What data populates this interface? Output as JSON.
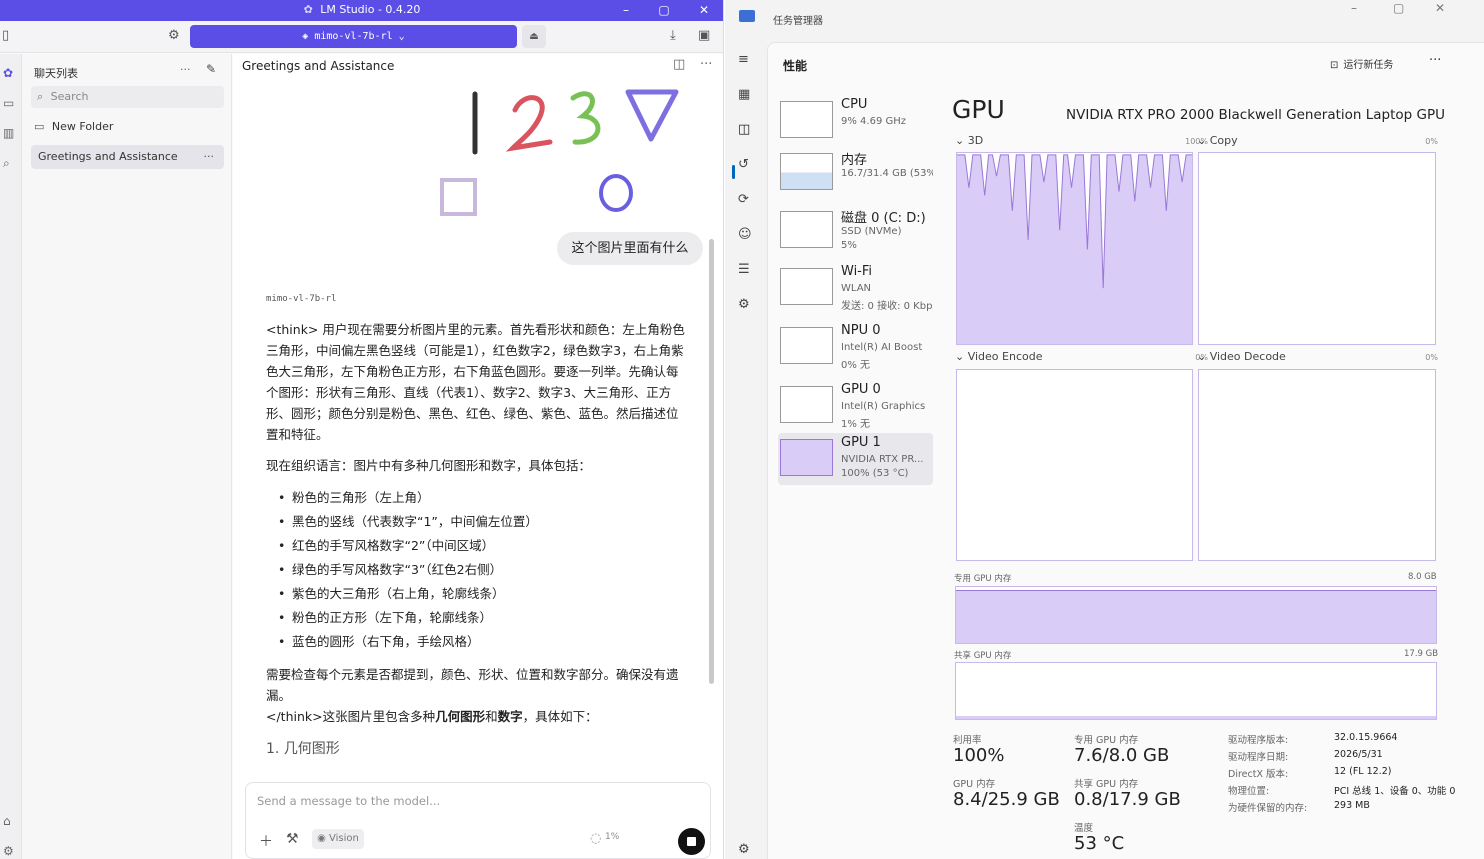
{
  "lmstudio": {
    "window_title": "LM Studio - 0.4.20",
    "model_selector": "mimo-vl-7b-rl",
    "sidebar": {
      "header": "聊天列表",
      "search_placeholder": "Search",
      "new_folder": "New Folder",
      "chats": [
        {
          "title": "Greetings and Assistance"
        }
      ]
    },
    "chat": {
      "title": "Greetings and Assistance",
      "user_message": "这个图片里面有什么",
      "model_tag": "mimo-vl-7b-rl",
      "think_p1": "<think> 用户现在需要分析图片里的元素。首先看形状和颜色：左上角粉色三角形，中间偏左黑色竖线（可能是1），红色数字2，绿色数字3，右上角紫色大三角形，左下角粉色正方形，右下角蓝色圆形。要逐一列举。先确认每个图形：形状有三角形、直线（代表1）、数字2、数字3、大三角形、正方形、圆形；颜色分别是粉色、黑色、红色、绿色、紫色、蓝色。然后描述位置和特征。",
      "think_p2": "现在组织语言：图片中有多种几何图形和数字，具体包括：",
      "bullets": [
        "粉色的三角形（左上角）",
        "黑色的竖线（代表数字“1”，中间偏左位置）",
        "红色的手写风格数字“2”（中间区域）",
        "绿色的手写风格数字“3”（红色2右侧）",
        "紫色的大三角形（右上角，轮廓线条）",
        "粉色的正方形（左下角，轮廓线条）",
        "蓝色的圆形（右下角，手绘风格）"
      ],
      "think_p3": "需要检查每个元素是否都提到，颜色、形状、位置和数字部分。确保没有遗漏。",
      "answer_prefix": "</think>这张图片里包含多种",
      "answer_bold1": "几何图形",
      "answer_mid": "和",
      "answer_bold2": "数字",
      "answer_suffix": "，具体如下：",
      "heading1": "1. 几何图形",
      "input_placeholder": "Send a message to the model...",
      "vision_label": "Vision",
      "context_usage": "1%"
    },
    "image_content": {
      "digits": [
        "1",
        "2",
        "3"
      ],
      "colors": {
        "digit1": "#333333",
        "digit2": "#d9545f",
        "digit3": "#78c155",
        "triangle": "#7e6fe0",
        "square": "#c8b8dc",
        "circle": "#6a5fe0"
      }
    }
  },
  "taskmanager": {
    "window_title": "任务管理器",
    "page_title": "性能",
    "run_new_task": "运行新任务",
    "devices": [
      {
        "name": "CPU",
        "sub1": "9%  4.69 GHz",
        "sub2": ""
      },
      {
        "name": "内存",
        "sub1": "16.7/31.4 GB (53%)",
        "sub2": ""
      },
      {
        "name": "磁盘 0 (C: D:)",
        "sub1": "SSD (NVMe)",
        "sub2": "5%"
      },
      {
        "name": "Wi-Fi",
        "sub1": "WLAN",
        "sub2": "发送: 0 接收: 0 Kbps"
      },
      {
        "name": "NPU 0",
        "sub1": "Intel(R) AI Boost",
        "sub2": "0% 无"
      },
      {
        "name": "GPU 0",
        "sub1": "Intel(R) Graphics",
        "sub2": "1% 无"
      },
      {
        "name": "GPU 1",
        "sub1": "NVIDIA RTX PR...",
        "sub2": "100% (53 °C)"
      }
    ],
    "gpu": {
      "title": "GPU",
      "model": "NVIDIA RTX PRO 2000 Blackwell Generation Laptop GPU",
      "engines": [
        {
          "label": "3D",
          "pct": "100%"
        },
        {
          "label": "Copy",
          "pct": "0%"
        },
        {
          "label": "Video Encode",
          "pct": "0%"
        },
        {
          "label": "Video Decode",
          "pct": "0%"
        }
      ],
      "dedicated_mem_label": "专用 GPU 内存",
      "dedicated_mem_max": "8.0 GB",
      "shared_mem_label": "共享 GPU 内存",
      "shared_mem_max": "17.9 GB",
      "stats": {
        "utilization_label": "利用率",
        "utilization": "100%",
        "dedicated_label": "专用 GPU 内存",
        "dedicated": "7.6/8.0 GB",
        "gpu_mem_label": "GPU 内存",
        "gpu_mem": "8.4/25.9 GB",
        "shared_label": "共享 GPU 内存",
        "shared": "0.8/17.9 GB",
        "temp_label": "温度",
        "temp": "53 °C"
      },
      "details": [
        {
          "k": "驱动程序版本:",
          "v": "32.0.15.9664"
        },
        {
          "k": "驱动程序日期:",
          "v": "2026/5/31"
        },
        {
          "k": "DirectX 版本:",
          "v": "12 (FL 12.2)"
        },
        {
          "k": "物理位置:",
          "v": "PCI 总线 1、设备 0、功能 0"
        },
        {
          "k": "为硬件保留的内存:",
          "v": "293 MB"
        }
      ],
      "dedicated_fill": 0.95,
      "shared_fill": 0.045
    },
    "colors": {
      "accent": "#0067c0",
      "gpu_graph_fill": "#d9ccf6",
      "gpu_graph_line": "#9a78d8"
    }
  }
}
